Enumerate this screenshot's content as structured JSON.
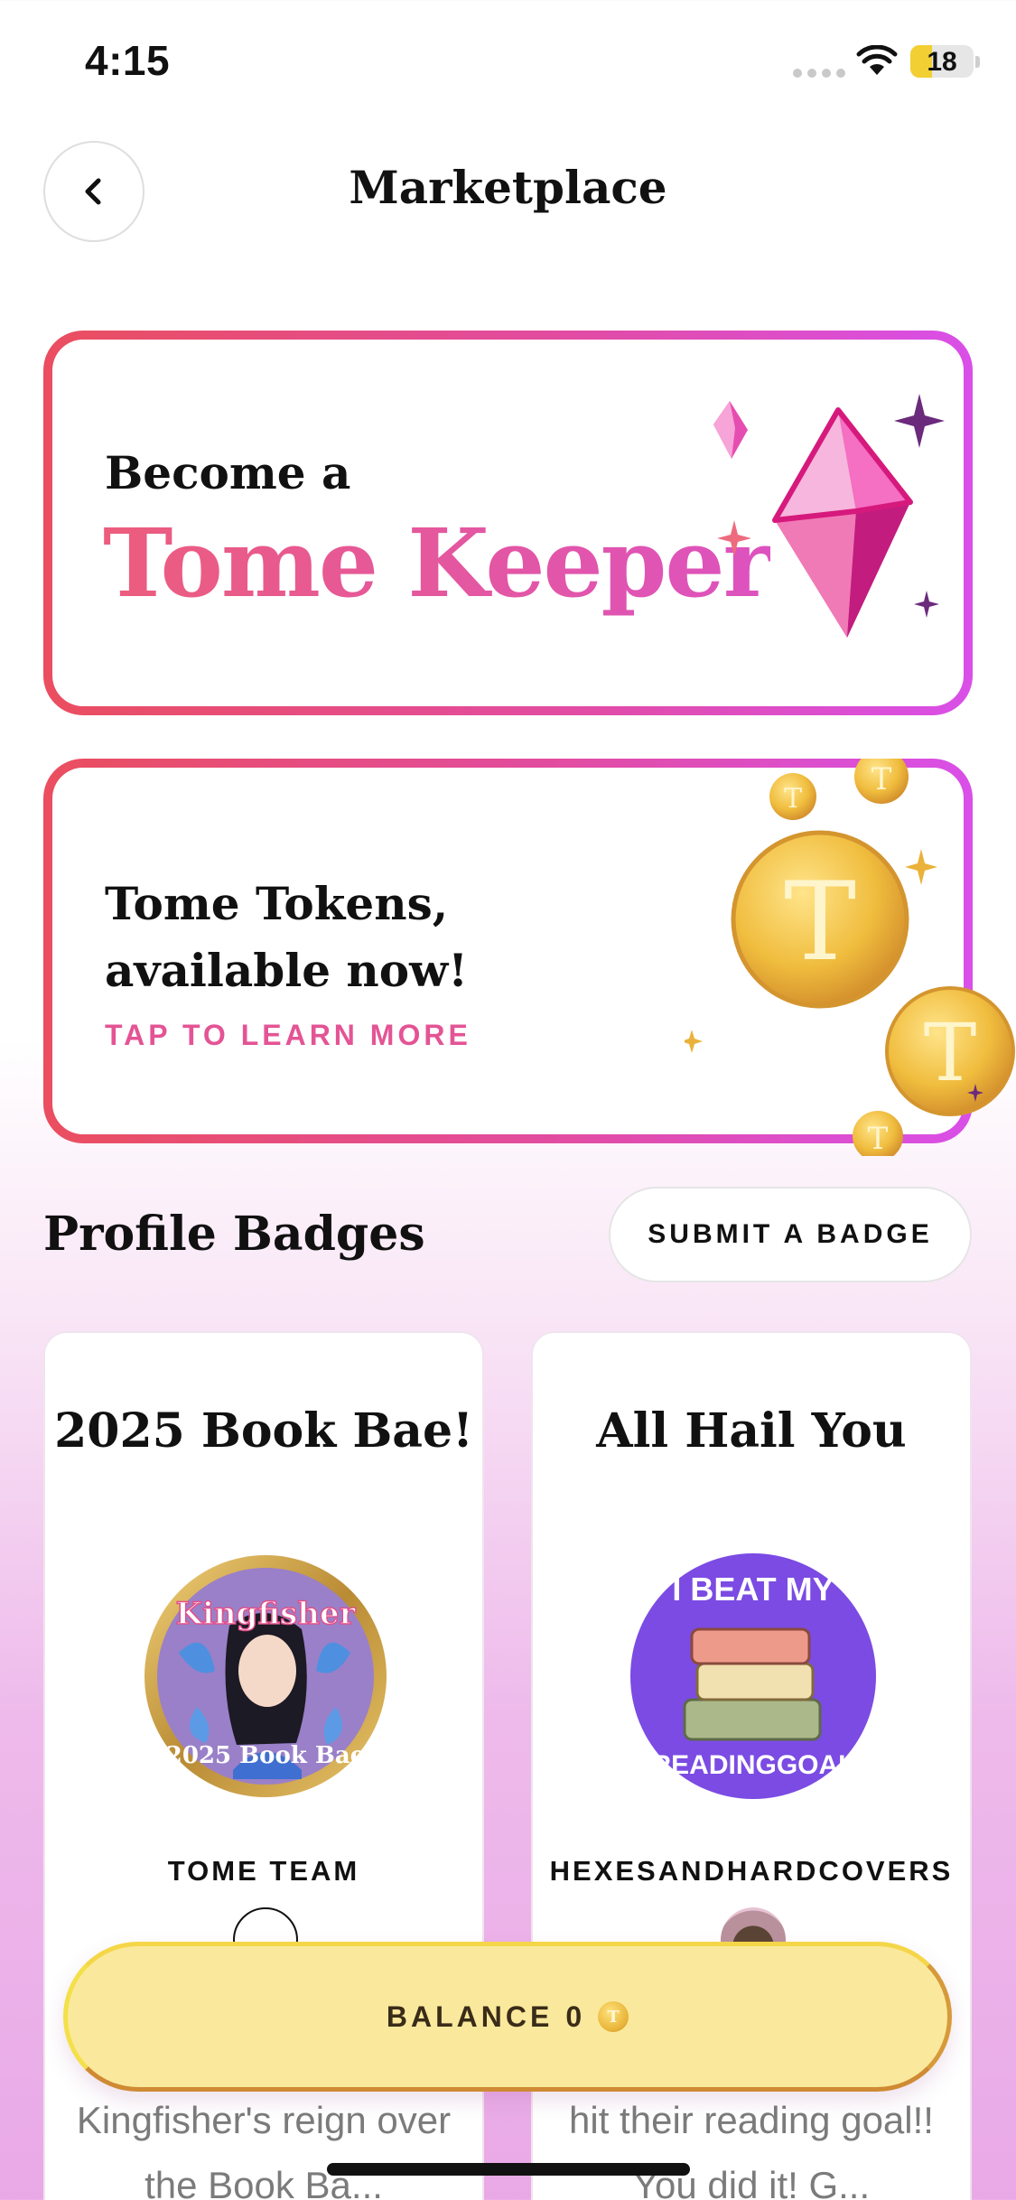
{
  "status_bar": {
    "time": "4:15",
    "battery": "18"
  },
  "header": {
    "title": "Marketplace",
    "back_icon": "chevron-left-icon"
  },
  "promos": {
    "keeper": {
      "line1": "Become a",
      "line2": "Tome Keeper",
      "icon": "gem-icon"
    },
    "tokens": {
      "title": "Tome Tokens, available now!",
      "cta": "TAP TO LEARN MORE",
      "icon": "coins-icon",
      "coin_letter": "T"
    }
  },
  "badges": {
    "title": "Profile Badges",
    "submit_label": "SUBMIT A BADGE",
    "items": [
      {
        "name": "2025 Book Bae!",
        "author": "TOME TEAM",
        "description": "Kingfisher's reign over the Book Ba...",
        "badge_text_top": "Kingfisher",
        "badge_text_bottom": "2025 Book Bae"
      },
      {
        "name": "All Hail You",
        "author": "HEXESANDHARDCOVERS",
        "description": "hit their reading goal!! You did it! G...",
        "badge_text_top": "I BEAT MY",
        "badge_text_bottom": "READINGGOAL"
      }
    ]
  },
  "balance": {
    "label": "BALANCE",
    "value": "0",
    "coin_letter": "T"
  },
  "colors": {
    "accent_pink": "#e45495",
    "gradient_start": "#ea4e5f",
    "gradient_end": "#d94fe8",
    "balance_bg": "#fae99c"
  }
}
